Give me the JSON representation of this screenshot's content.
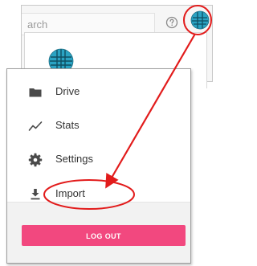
{
  "header": {
    "search_text": "arch",
    "help_icon": "help-circle-icon",
    "avatar_icon": "avatar-globe-icon"
  },
  "account": {
    "avatar_icon": "avatar-globe-icon"
  },
  "menu": {
    "items": [
      {
        "label": "Drive",
        "icon": "folder-icon"
      },
      {
        "label": "Stats",
        "icon": "line-chart-icon"
      },
      {
        "label": "Settings",
        "icon": "gear-icon"
      },
      {
        "label": "Import",
        "icon": "download-icon"
      }
    ],
    "logout_label": "LOG OUT"
  },
  "colors": {
    "logout_button": "#f2487f",
    "annotation": "#e21b1b",
    "avatar": "#2aa3c3"
  }
}
